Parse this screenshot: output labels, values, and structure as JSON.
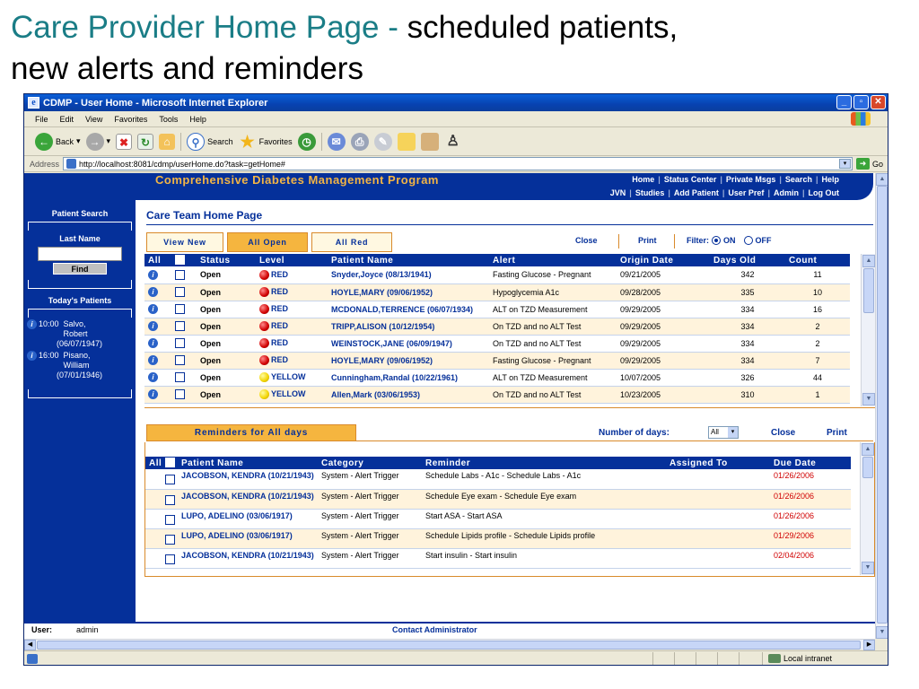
{
  "slide": {
    "title_teal": "Care Provider Home Page - ",
    "title_rest": "scheduled patients,",
    "title_line2": "new alerts and reminders"
  },
  "browser": {
    "window_title": "CDMP - User Home - Microsoft Internet Explorer",
    "menu": [
      "File",
      "Edit",
      "View",
      "Favorites",
      "Tools",
      "Help"
    ],
    "toolbar": {
      "back": "Back",
      "search": "Search",
      "favorites": "Favorites"
    },
    "address_label": "Address",
    "address_url": "http://localhost:8081/cdmp/userHome.do?task=getHome#",
    "go_label": "Go",
    "status_zone": "Local intranet"
  },
  "app": {
    "program_title": "Comprehensive Diabetes Management Program",
    "nav_row1": [
      "Home",
      "Status Center",
      "Private Msgs",
      "Search",
      "Help"
    ],
    "nav_row2": [
      "JVN",
      "Studies",
      "Add Patient",
      "User Pref",
      "Admin",
      "Log Out"
    ],
    "sidebar": {
      "patient_search": "Patient Search",
      "last_name": "Last Name",
      "find_button": "Find",
      "todays_patients": "Today's Patients",
      "appointments": [
        {
          "time": "10:00",
          "text": "10:00  Salvo,\n           Robert\n        (06/07/1947)"
        },
        {
          "time": "16:00",
          "text": "16:00  Pisano,\n           William\n        (07/01/1946)"
        }
      ]
    },
    "page_heading": "Care Team Home Page",
    "tabs": [
      {
        "label": "View New",
        "active": false
      },
      {
        "label": "All Open",
        "active": true
      },
      {
        "label": "All Red",
        "active": false
      }
    ],
    "actions": {
      "close": "Close",
      "print": "Print"
    },
    "filter": {
      "label": "Filter:",
      "on": "ON",
      "off": "OFF",
      "selected": "ON"
    },
    "alerts_table": {
      "headers": [
        "All",
        "",
        "Status",
        "Level",
        "Patient Name",
        "Alert",
        "Origin Date",
        "Days Old",
        "Count"
      ],
      "rows": [
        {
          "status": "Open",
          "level": "RED",
          "patient": "Snyder,Joyce (08/13/1941)",
          "alert": "Fasting Glucose - Pregnant",
          "origin": "09/21/2005",
          "days": "342",
          "count": "11"
        },
        {
          "status": "Open",
          "level": "RED",
          "patient": "HOYLE,MARY (09/06/1952)",
          "alert": "Hypoglycemia A1c",
          "origin": "09/28/2005",
          "days": "335",
          "count": "10"
        },
        {
          "status": "Open",
          "level": "RED",
          "patient": "MCDONALD,TERRENCE (06/07/1934)",
          "alert": "ALT on TZD Measurement",
          "origin": "09/29/2005",
          "days": "334",
          "count": "16"
        },
        {
          "status": "Open",
          "level": "RED",
          "patient": "TRIPP,ALISON (10/12/1954)",
          "alert": "On TZD and no ALT Test",
          "origin": "09/29/2005",
          "days": "334",
          "count": "2"
        },
        {
          "status": "Open",
          "level": "RED",
          "patient": "WEINSTOCK,JANE (06/09/1947)",
          "alert": "On TZD and no ALT Test",
          "origin": "09/29/2005",
          "days": "334",
          "count": "2"
        },
        {
          "status": "Open",
          "level": "RED",
          "patient": "HOYLE,MARY (09/06/1952)",
          "alert": "Fasting Glucose - Pregnant",
          "origin": "09/29/2005",
          "days": "334",
          "count": "7"
        },
        {
          "status": "Open",
          "level": "YELLOW",
          "patient": "Cunningham,Randal (10/22/1961)",
          "alert": "ALT on TZD Measurement",
          "origin": "10/07/2005",
          "days": "326",
          "count": "44"
        },
        {
          "status": "Open",
          "level": "YELLOW",
          "patient": "Allen,Mark (03/06/1953)",
          "alert": "On TZD and no ALT Test",
          "origin": "10/23/2005",
          "days": "310",
          "count": "1"
        }
      ]
    },
    "reminders": {
      "tab_label": "Reminders for All days",
      "days_label": "Number of days:",
      "days_value": "All",
      "close": "Close",
      "print": "Print",
      "headers": [
        "All",
        "",
        "Patient Name",
        "Category",
        "Reminder",
        "Assigned To",
        "Due Date"
      ],
      "rows": [
        {
          "patient": "JACOBSON, KENDRA (10/21/1943)",
          "category": "System - Alert Trigger",
          "reminder": "Schedule Labs - A1c - Schedule Labs - A1c",
          "assigned": "",
          "due": "01/26/2006"
        },
        {
          "patient": "JACOBSON, KENDRA (10/21/1943)",
          "category": "System - Alert Trigger",
          "reminder": "Schedule Eye exam - Schedule Eye exam",
          "assigned": "",
          "due": "01/26/2006"
        },
        {
          "patient": "LUPO, ADELINO (03/06/1917)",
          "category": "System - Alert Trigger",
          "reminder": "Start ASA - Start ASA",
          "assigned": "",
          "due": "01/26/2006"
        },
        {
          "patient": "LUPO, ADELINO (03/06/1917)",
          "category": "System - Alert Trigger",
          "reminder": "Schedule Lipids profile - Schedule Lipids profile",
          "assigned": "",
          "due": "01/29/2006"
        },
        {
          "patient": "JACOBSON, KENDRA (10/21/1943)",
          "category": "System - Alert Trigger",
          "reminder": "Start insulin - Start insulin",
          "assigned": "",
          "due": "02/04/2006"
        }
      ]
    },
    "footer": {
      "user_label": "User:",
      "user_value": "admin",
      "contact": "Contact Administrator"
    },
    "colors": {
      "navy": "#05309a",
      "orange": "#f5b53f",
      "teal": "#1a7d86",
      "red_due": "#d00000"
    }
  }
}
